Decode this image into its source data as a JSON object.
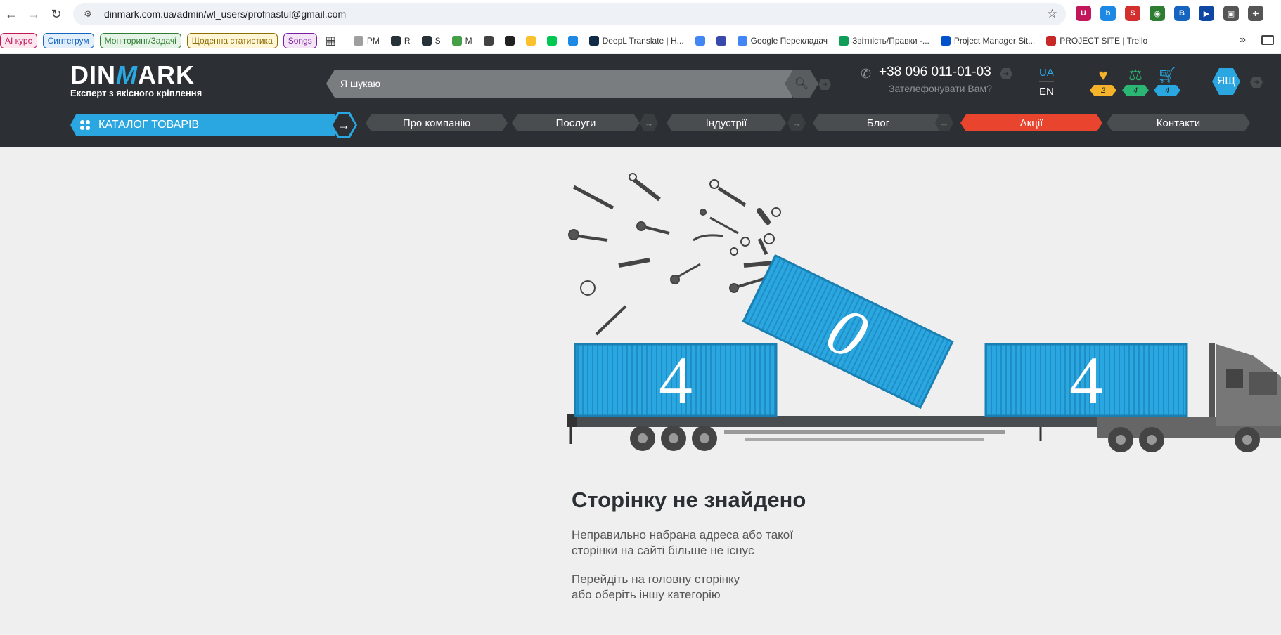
{
  "browser": {
    "url": "dinmark.com.ua/admin/wl_users/profnastul@gmail.com",
    "extensions": [
      {
        "icon": "shield-extension-icon",
        "color": "#c2185b",
        "glyph": "U"
      },
      {
        "icon": "b-extension-icon",
        "color": "#1e88e5",
        "glyph": "b"
      },
      {
        "icon": "s-extension-icon",
        "color": "#d32f2f",
        "glyph": "S"
      },
      {
        "icon": "record-extension-icon",
        "color": "#2e7d32",
        "glyph": "◉"
      },
      {
        "icon": "color-extension-icon",
        "color": "#1565c0",
        "glyph": "B"
      },
      {
        "icon": "flag-extension-icon",
        "color": "#0d47a1",
        "glyph": "▶"
      },
      {
        "icon": "image-extension-icon",
        "color": "#555555",
        "glyph": "▣"
      },
      {
        "icon": "puzzle-extension-icon",
        "color": "#555555",
        "glyph": "✚"
      }
    ]
  },
  "bookmarks": {
    "chips": [
      {
        "label": "AI курс",
        "color": "#c2185b",
        "bg": "#fde7ef"
      },
      {
        "label": "Синтегрум",
        "color": "#1565c0",
        "bg": "#e3f0fc"
      },
      {
        "label": "Моніторинг/Задачі",
        "color": "#2e7d32",
        "bg": "#e6f4e7"
      },
      {
        "label": "Щоденна статистика",
        "color": "#8d6e00",
        "bg": "#fff6d8"
      },
      {
        "label": "Songs",
        "color": "#7b1fa2",
        "bg": "#f3e5f5"
      }
    ],
    "items": [
      {
        "label": "PM",
        "color": "#9e9e9e"
      },
      {
        "label": "R",
        "color": "#263238"
      },
      {
        "label": "S",
        "color": "#263238"
      },
      {
        "label": "M",
        "color": "#43a047"
      },
      {
        "label": "",
        "color": "#424242"
      },
      {
        "label": "",
        "color": "#212121"
      },
      {
        "label": "",
        "color": "#fbc02d"
      },
      {
        "label": "",
        "color": "#00c853"
      },
      {
        "label": "",
        "color": "#1e88e5"
      },
      {
        "label": "DeepL Translate | Н...",
        "color": "#0f2b46"
      },
      {
        "label": "",
        "color": "#4285f4"
      },
      {
        "label": "",
        "color": "#3949ab"
      },
      {
        "label": "Google Перекладач",
        "color": "#4285f4"
      },
      {
        "label": "Звітність/Правки -...",
        "color": "#0f9d58"
      },
      {
        "label": "Project Manager Sit...",
        "color": "#0052cc"
      },
      {
        "label": "PROJECT SITE | Trello",
        "color": "#c62828"
      }
    ]
  },
  "header": {
    "logo_brand_a": "DIN",
    "logo_brand_m": "M",
    "logo_brand_b": "ARK",
    "logo_tagline": "Експерт з якісного кріплення",
    "search_placeholder": "Я шукаю",
    "phone": "+38 096 011-01-03",
    "callback": "Зателефонувати Вам?",
    "lang_ua": "UA",
    "lang_en": "EN",
    "favorites_count": "2",
    "compare_count": "4",
    "cart_count": "4",
    "avatar_initials": "ЯЩ"
  },
  "nav": {
    "catalog_label": "КАТАЛОГ ТОВАРІВ",
    "items": [
      {
        "label": "Про компанію"
      },
      {
        "label": "Послуги"
      },
      {
        "label": "Індустрії"
      },
      {
        "label": "Блог"
      },
      {
        "label": "Акції"
      },
      {
        "label": "Контакти"
      }
    ]
  },
  "error": {
    "digit_1": "4",
    "digit_2": "0",
    "digit_3": "4",
    "title": "Сторінку не знайдено",
    "desc_line1": "Неправильно набрана адреса або такої",
    "desc_line2": "сторінки на сайті більше не існує",
    "goto_prefix": "Перейдіть на ",
    "goto_link": "головну сторінку",
    "goto_suffix": "або оберіть іншу категорію"
  },
  "colors": {
    "brand_blue": "#2aa6e0",
    "header_bg": "#2c2f33",
    "promo_red": "#e8442e",
    "fav_yellow": "#f5b32c",
    "compare_green": "#2bb673",
    "cart_blue": "#2aa6e0"
  }
}
